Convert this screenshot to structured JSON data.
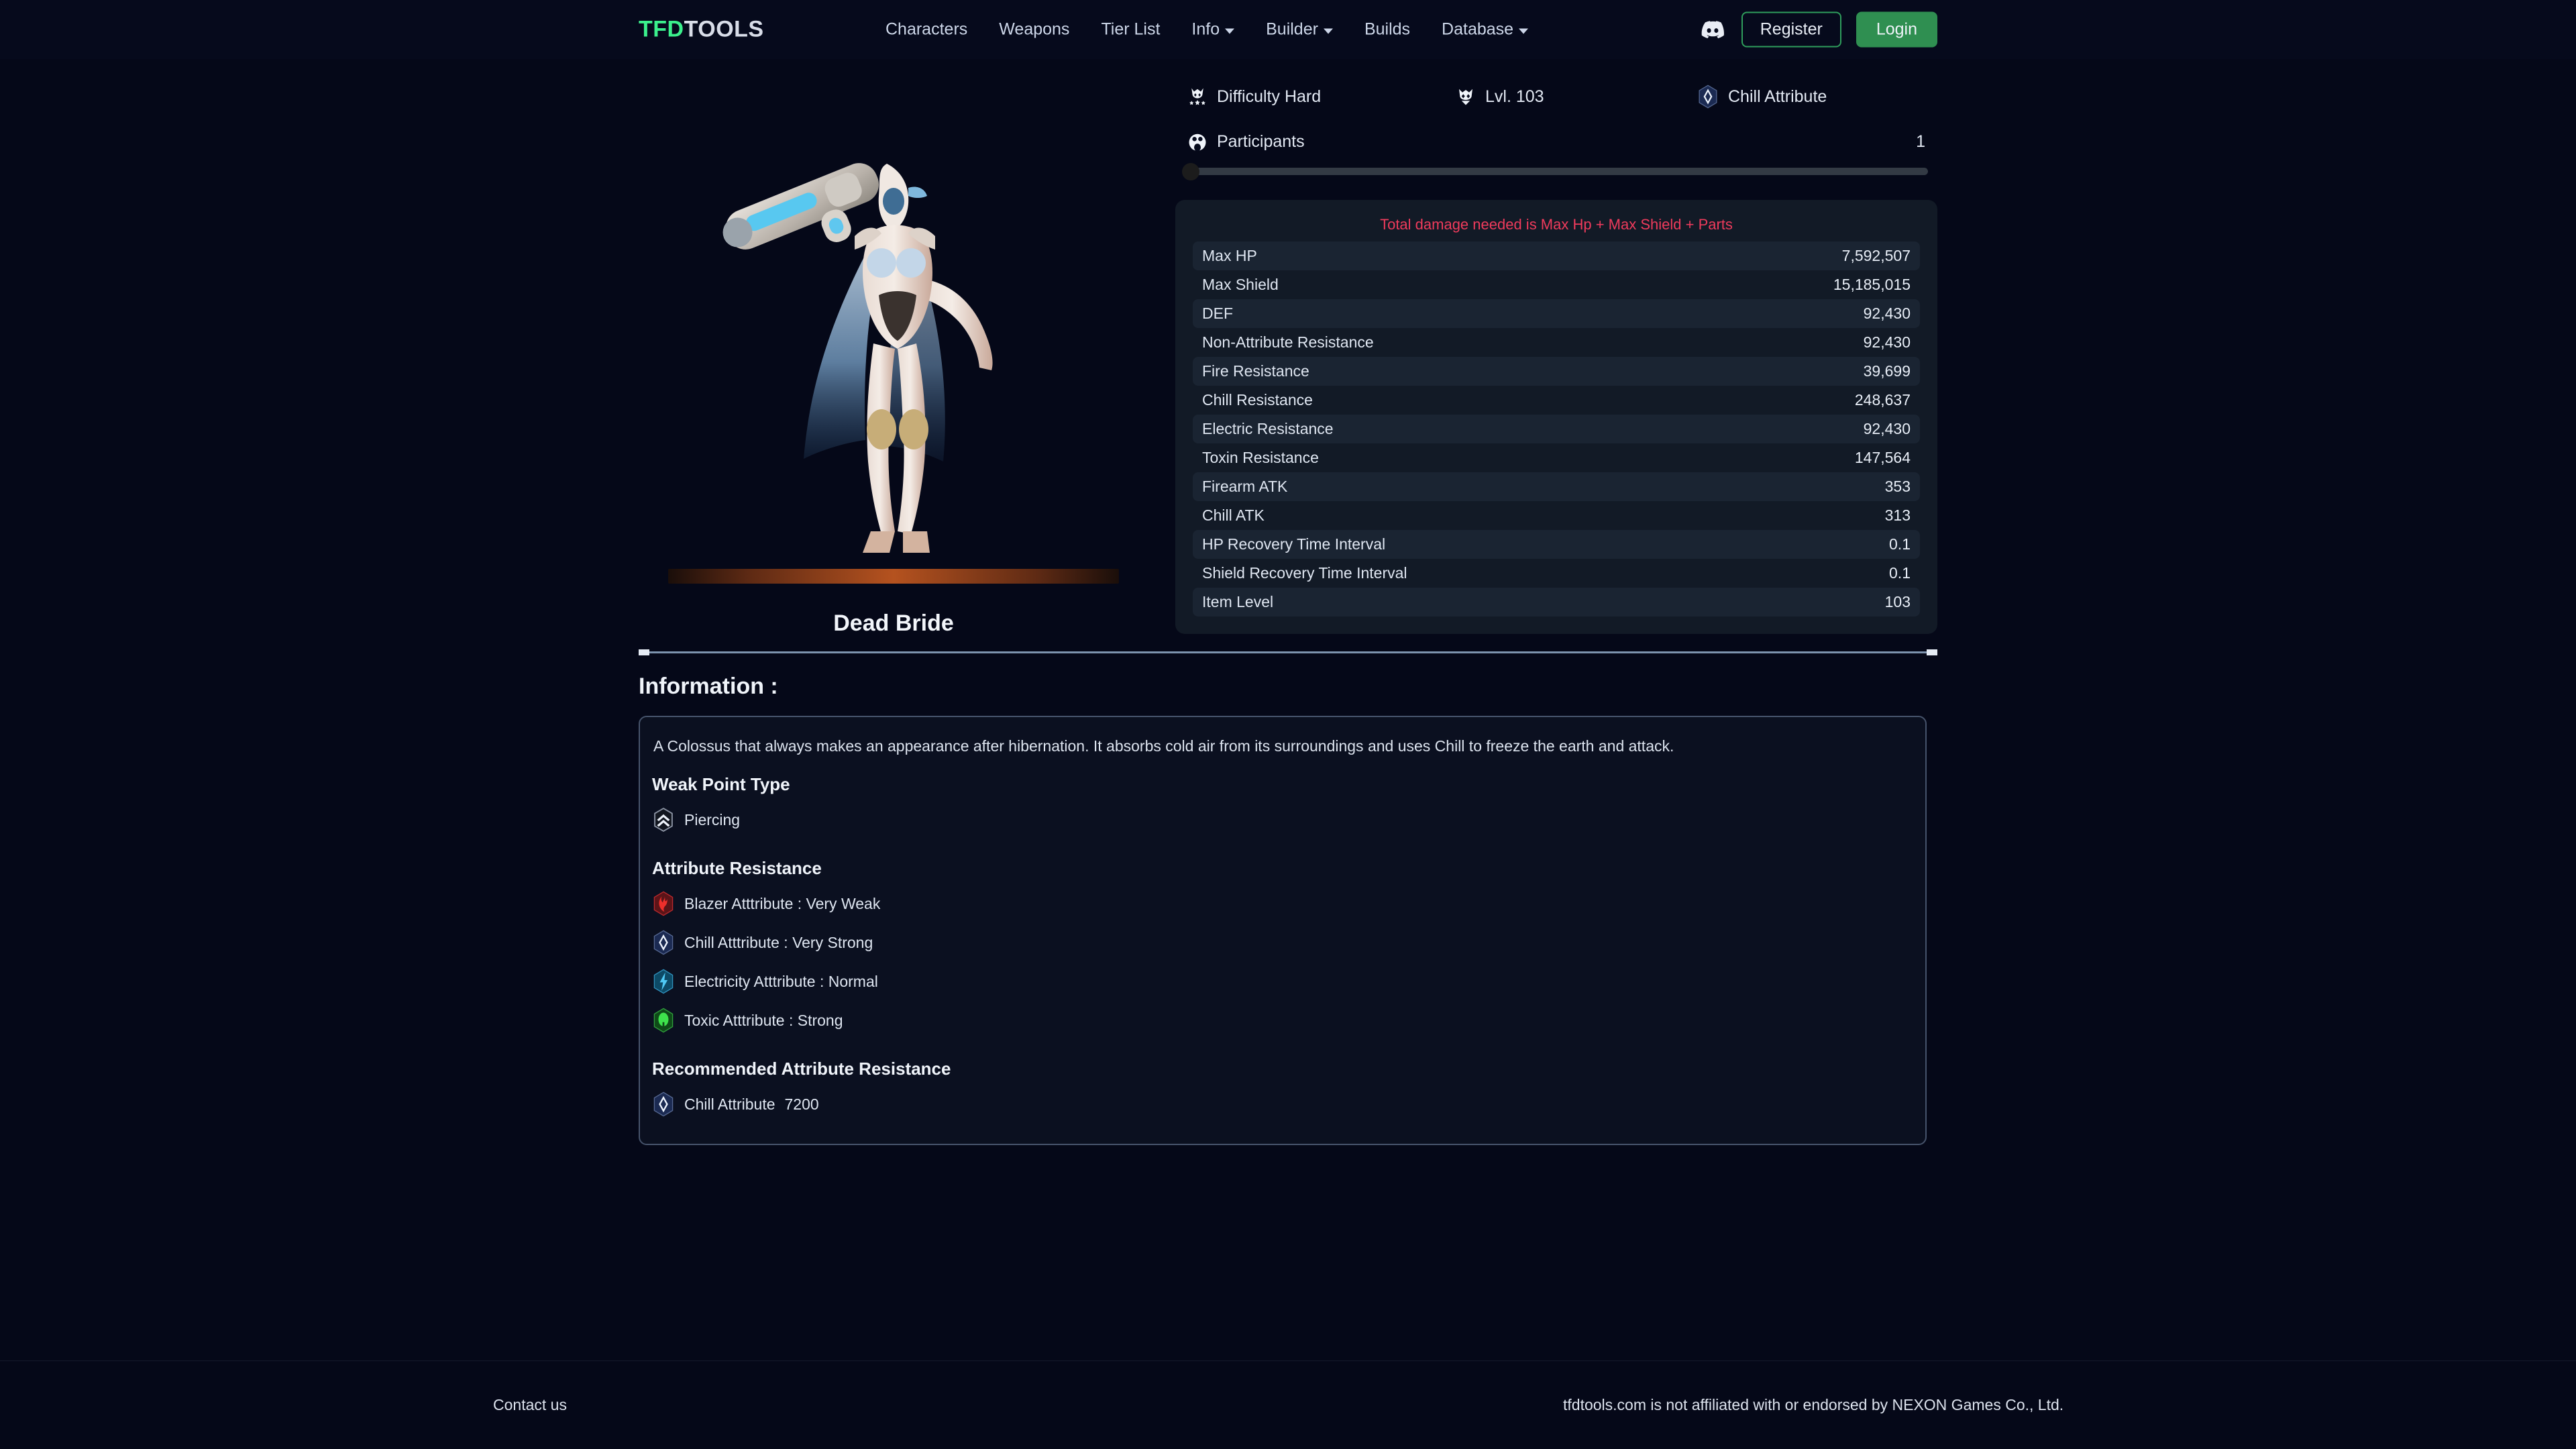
{
  "navbar": {
    "logo_tfd": "TFD",
    "logo_tools": "TOOLS",
    "links": [
      {
        "label": "Characters",
        "has_caret": false
      },
      {
        "label": "Weapons",
        "has_caret": false
      },
      {
        "label": "Tier List",
        "has_caret": false
      },
      {
        "label": "Info",
        "has_caret": true
      },
      {
        "label": "Builder",
        "has_caret": true
      },
      {
        "label": "Builds",
        "has_caret": false
      },
      {
        "label": "Database",
        "has_caret": true
      }
    ],
    "register_label": "Register",
    "login_label": "Login",
    "discord_icon": "discord-icon",
    "accent_green": "#3bf08c",
    "login_bg": "#2f8f51",
    "register_border": "#2f9e5c"
  },
  "boss": {
    "name": "Dead Bride"
  },
  "meta": {
    "difficulty": "Difficulty Hard",
    "difficulty_icon": "skull-stars-icon",
    "level": "Lvl. 103",
    "level_icon": "skull-icon",
    "attribute": "Chill Attribute",
    "attribute_icon": "chill-crystal-icon",
    "participants_label": "Participants",
    "participants_icon": "participants-icon",
    "participants_value": "1",
    "slider_percent": 0
  },
  "stats": {
    "note": "Total damage needed is Max Hp + Max Shield + Parts",
    "note_color": "#ef3b5c",
    "rows": [
      {
        "label": "Max HP",
        "value": "7,592,507"
      },
      {
        "label": "Max Shield",
        "value": "15,185,015"
      },
      {
        "label": "DEF",
        "value": "92,430"
      },
      {
        "label": "Non-Attribute Resistance",
        "value": "92,430"
      },
      {
        "label": "Fire Resistance",
        "value": "39,699"
      },
      {
        "label": "Chill Resistance",
        "value": "248,637"
      },
      {
        "label": "Electric Resistance",
        "value": "92,430"
      },
      {
        "label": "Toxin Resistance",
        "value": "147,564"
      },
      {
        "label": "Firearm ATK",
        "value": "353"
      },
      {
        "label": "Chill ATK",
        "value": "313"
      },
      {
        "label": "HP Recovery Time Interval",
        "value": "0.1"
      },
      {
        "label": "Shield Recovery Time Interval",
        "value": "0.1"
      },
      {
        "label": "Item Level",
        "value": "103"
      }
    ]
  },
  "information": {
    "title": "Information :",
    "description": "A Colossus that always makes an appearance after hibernation. It absorbs cold air from its surroundings and uses Chill to freeze the earth and attack.",
    "weak_point_heading": "Weak Point Type",
    "weak_point": {
      "label": "Piercing",
      "icon": "piercing-chevron-icon"
    },
    "attribute_resistance_heading": "Attribute Resistance",
    "attribute_resistance": [
      {
        "label": "Blazer Atttribute : Very Weak",
        "icon": "fire-icon",
        "color": "#e8322f"
      },
      {
        "label": "Chill Atttribute : Very Strong",
        "icon": "chill-crystal-icon",
        "color": "#cfe0f5"
      },
      {
        "label": "Electricity Atttribute : Normal",
        "icon": "lightning-icon",
        "color": "#3fb9e8"
      },
      {
        "label": "Toxic Atttribute : Strong",
        "icon": "toxin-icon",
        "color": "#3ed145"
      }
    ],
    "recommended_heading": "Recommended Attribute Resistance",
    "recommended": {
      "label": "Chill Attribute",
      "value": "7200",
      "icon": "chill-crystal-icon"
    }
  },
  "footer": {
    "contact": "Contact us",
    "disclaimer": "tfdtools.com is not affiliated with or endorsed by NEXON Games Co., Ltd."
  }
}
